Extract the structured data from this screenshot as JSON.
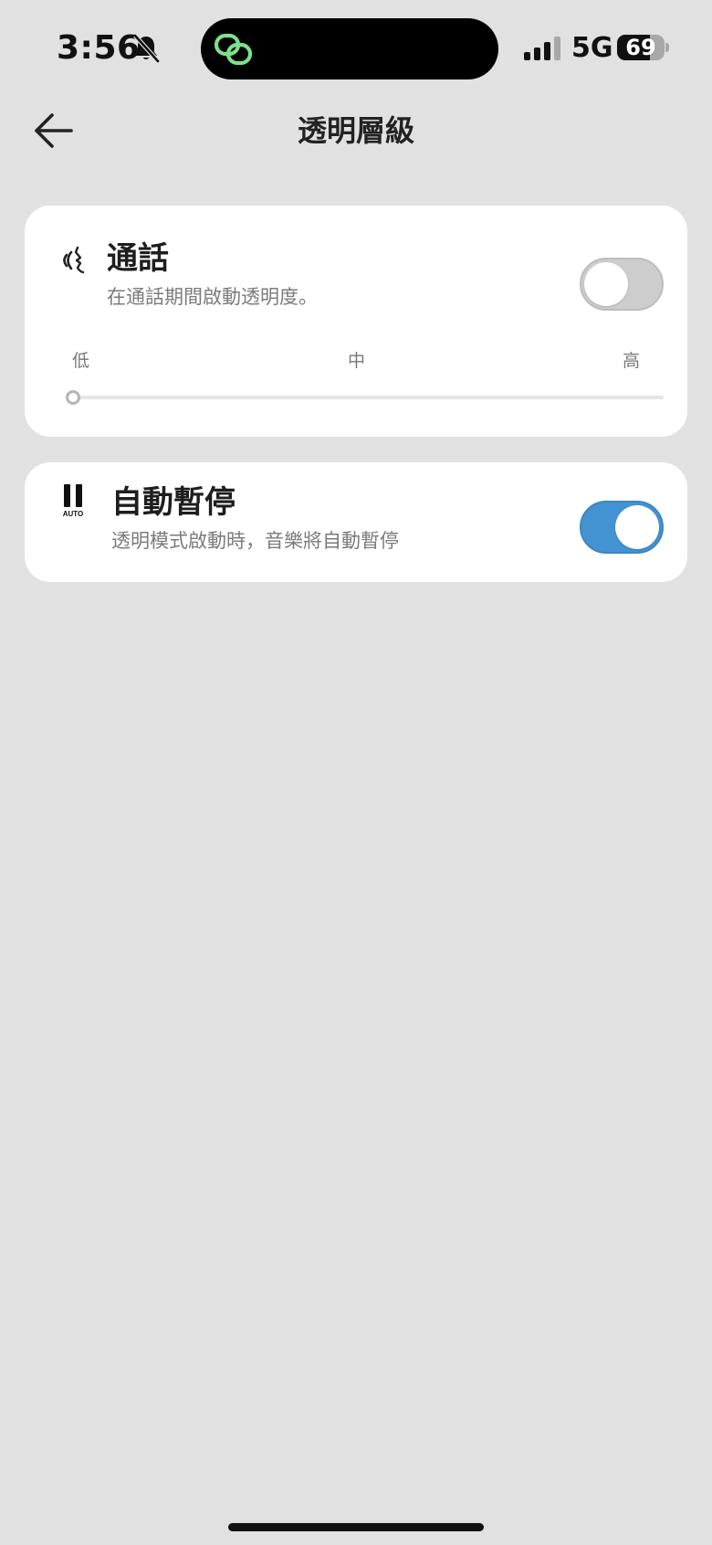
{
  "status_bar": {
    "time": "3:56",
    "network": "5G",
    "battery_level": "69",
    "battery_fraction": 0.69
  },
  "header": {
    "title": "透明層級"
  },
  "call_card": {
    "icon": "voice-call-icon",
    "title": "通話",
    "subtitle": "在通話期間啟動透明度。",
    "toggle_on": false,
    "levels": {
      "low": "低",
      "mid": "中",
      "high": "高"
    },
    "slider_value": 0
  },
  "auto_pause_card": {
    "icon": "auto-pause-icon",
    "icon_caption": "AUTO",
    "title": "自動暫停",
    "subtitle": "透明模式啟動時，音樂將自動暫停",
    "toggle_on": true
  },
  "colors": {
    "background": "#e1e1e1",
    "card": "#ffffff",
    "toggle_on": "#4393d3",
    "toggle_off": "#cdcdcd",
    "island_icon": "#7ee08a"
  }
}
